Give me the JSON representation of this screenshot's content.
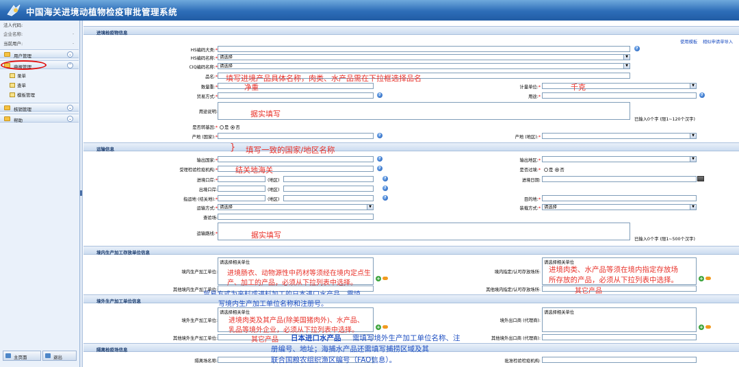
{
  "app": {
    "title": "中国海关进境动植物检疫审批管理系统"
  },
  "sidebar": {
    "legal_code_label": "法人代码:",
    "company_label": "企业名称:",
    "company_value": ".",
    "user_label": "当前用户:",
    "user_value": ".",
    "groups": [
      {
        "label": "用户管理"
      },
      {
        "label": "申报管理"
      },
      {
        "label": "核销管理"
      },
      {
        "label": "帮助"
      }
    ],
    "items": [
      {
        "label": "录单"
      },
      {
        "label": "查单"
      },
      {
        "label": "模板管理"
      }
    ],
    "home_button": "主页面",
    "exit_button": "退出"
  },
  "toplinks": {
    "use_template": "使用模板",
    "similar_apply": "相似申请单导入"
  },
  "sections": {
    "product": "进境检疫物信息",
    "transport": "运输信息",
    "domestic": "境内生产加工存放单位信息",
    "foreign": "境外生产加工单位信息",
    "quarantine": "隔离检疫场信息"
  },
  "form": {
    "hs_category": "HS编码大类:",
    "hs_name": "HS编码名称:",
    "hs_name_value": "请选择",
    "ciq_name": "CIQ编码名称:",
    "ciq_name_value": "请选择",
    "product_name": "品名:",
    "quantity": "数量重:",
    "unit": "计量单位:",
    "trade_mode": "贸易方式:",
    "usage": "用途:",
    "usage_desc": "用途说明:",
    "char_hint_1": "已输入0个字 (限1~120个汉字)",
    "transgenic": "是否转基因:",
    "yes": "是",
    "no": "否",
    "origin_country": "产地 (国家):",
    "origin_region": "产地 (地区):",
    "export_country": "输出国家:",
    "export_region": "输出地区:",
    "inspection_org": "受理检验检疫机构:",
    "transit": "是否过境:",
    "entry_port": "进境口岸:",
    "region_tag": "(地区)",
    "entry_date": "进境日期:",
    "exit_port": "出境口岸:",
    "destination_port": "指运地 (结关地):",
    "destination": "目的地:",
    "transport_mode": "运输方式:",
    "transport_mode_value": "请选择",
    "packing_mode": "装载方式:",
    "packing_mode_value": "请选择",
    "inspection_site": "查验场:",
    "route": "运输路线:",
    "char_hint_2": "已输入0个字 (限1~500个汉字)",
    "domestic_unit": "境内生产加工单位:",
    "other_domestic_unit": "其他境内生产加工单位:",
    "designated_store": "境内指定/认可存放场所:",
    "other_designated_store": "其他境内指定/认可存放场所:",
    "select_unit_placeholder": "请选择相关单位",
    "foreign_unit": "境外生产加工单位:",
    "other_foreign_unit": "其他境外生产加工单位:",
    "foreign_exporter": "境外出口商 (代理商):",
    "other_foreign_exporter": "其他境外出口商 (代理商):",
    "quarantine_site": "隔离场名称:",
    "approval_org": "批准检验检疫机构:"
  },
  "annotations": {
    "a1": "填写进境产品具体名称，肉类、水产品需在下拉框选择品名",
    "a2": "净重",
    "a3": "千克",
    "a4": "据实填写",
    "a5": "填写一致的国家/地区名称",
    "a6": "结关地海关",
    "a7": "据实填写",
    "a8": "进境肠衣、动物源性中药材等须经在境内定点生",
    "a8b": "产、加工的产品，必须从下拉列表中选择。",
    "a9": "贸易方式为来料或进料加工的日本进口水产品，需填",
    "a9b": "写境内生产加工单位名称和注册号。",
    "a10": "进境肉类、水产品等须在境内指定存放场",
    "a10b": "所存放的产品，必须从下拉列表中选择。",
    "a11": "其它产品",
    "a12": "进境肉类及其产品(除美国猪肉外)、水产品、",
    "a12b": "乳品等境外企业，必须从下拉列表中选择。",
    "a13": "其它产品",
    "a14a": "日本进口水产品",
    "a14b": "需填写境外生产加工单位名称、注",
    "a14c": "册编号、地址；海捕水产品还需填写捕捞区域及其",
    "a14d": "联合国粮农组织渔区编号（FAO信息）。"
  }
}
